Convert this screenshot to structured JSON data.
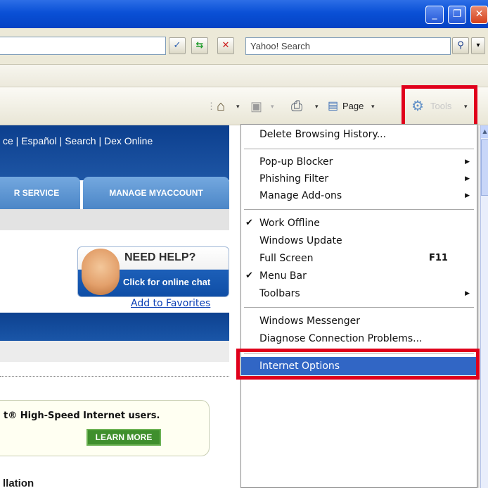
{
  "window": {
    "buttons": [
      {
        "name": "minimize",
        "glyph": "_"
      },
      {
        "name": "maximize",
        "glyph": "❐"
      },
      {
        "name": "close",
        "glyph": "✕"
      }
    ]
  },
  "address_bar": {
    "search_placeholder": "Yahoo! Search",
    "go_glyph": "✓",
    "refresh_glyph": "⇆",
    "stop_glyph": "✕",
    "search_glyph": "⚲"
  },
  "command_bar": {
    "home_glyph": "⌂",
    "feeds_glyph": "▣",
    "print_glyph": "⎙",
    "page_label": "Page",
    "tools_label": "Tools",
    "dropdown_glyph": "▾"
  },
  "web_page": {
    "top_links": "ce  |  Español  |  Search  |  Dex Online",
    "tabs": [
      "R SERVICE",
      "MANAGE MYACCOUNT"
    ],
    "help_title": "NEED HELP?",
    "help_subtitle": "Click for online chat",
    "favorites_link": "Add to Favorites",
    "promo_text": "t® High-Speed Internet users.",
    "learn_more": "LEARN MORE",
    "bottom_text": "llation"
  },
  "tools_menu": {
    "items": [
      {
        "label": "Delete Browsing History...",
        "checked": false,
        "submenu": false
      },
      {
        "label": "Pop-up Blocker",
        "checked": false,
        "submenu": true
      },
      {
        "label": "Phishing Filter",
        "checked": false,
        "submenu": true
      },
      {
        "label": "Manage Add-ons",
        "checked": false,
        "submenu": true
      },
      {
        "label": "Work Offline",
        "checked": true,
        "submenu": false
      },
      {
        "label": "Windows Update",
        "checked": false,
        "submenu": false
      },
      {
        "label": "Full Screen",
        "checked": false,
        "submenu": false,
        "shortcut": "F11"
      },
      {
        "label": "Menu Bar",
        "checked": true,
        "submenu": false
      },
      {
        "label": "Toolbars",
        "checked": false,
        "submenu": true
      },
      {
        "label": "Windows Messenger",
        "checked": false,
        "submenu": false
      },
      {
        "label": "Diagnose Connection Problems...",
        "checked": false,
        "submenu": false
      },
      {
        "label": "Internet Options",
        "checked": false,
        "submenu": false,
        "selected": true
      }
    ],
    "check_glyph": "✔",
    "submenu_glyph": "▶"
  },
  "colors": {
    "highlight_red": "#e0001b",
    "menu_selected": "#3166c5",
    "titlebar_blue": "#0a50d6"
  }
}
